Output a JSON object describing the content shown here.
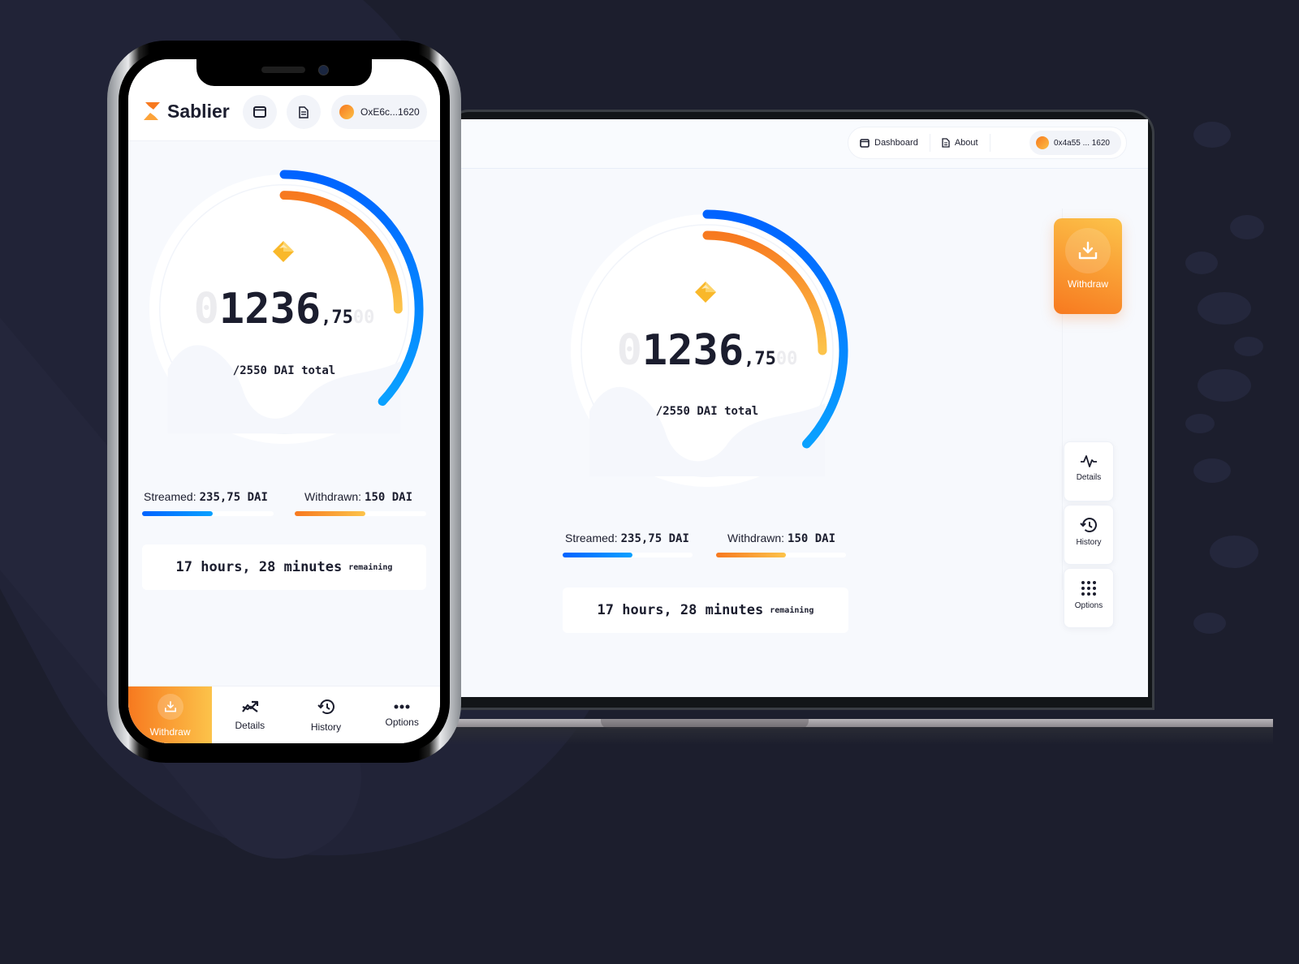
{
  "app": {
    "brand": "Sablier"
  },
  "laptop": {
    "nav": {
      "dashboard_label": "Dashboard",
      "about_label": "About",
      "wallet_address": "0x4a55 ... 1620"
    },
    "sidebar": {
      "withdraw_label": "Withdraw",
      "details_label": "Details",
      "history_label": "History",
      "options_label": "Options"
    }
  },
  "phone": {
    "wallet_address": "OxE6c...1620",
    "tabs": [
      {
        "label": "Withdraw",
        "icon": "download-icon",
        "active": true
      },
      {
        "label": "Details",
        "icon": "trend-icon",
        "active": false
      },
      {
        "label": "History",
        "icon": "history-icon",
        "active": false
      },
      {
        "label": "Options",
        "icon": "more-icon",
        "active": false
      }
    ]
  },
  "stream": {
    "counter_leading_ghost": "0",
    "counter_integer": "1236",
    "counter_decimal": ",75",
    "counter_trailing_ghost": "00",
    "total_label": "/2550 DAI total",
    "streamed_label": "Streamed:",
    "streamed_value": "235,75 DAI",
    "streamed_fraction": 0.54,
    "withdrawn_label": "Withdrawn:",
    "withdrawn_value": "150 DAI",
    "withdrawn_fraction": 0.54,
    "ring_streamed_fraction": 0.37,
    "ring_withdrawn_fraction": 0.25,
    "remaining_value": "17 hours, 28 minutes",
    "remaining_label": "remaining"
  },
  "colors": {
    "blue_start": "#0063ff",
    "blue_end": "#0aa1ff",
    "orange_start": "#f7791f",
    "orange_end": "#fcc34a",
    "text": "#1b1d2e"
  }
}
